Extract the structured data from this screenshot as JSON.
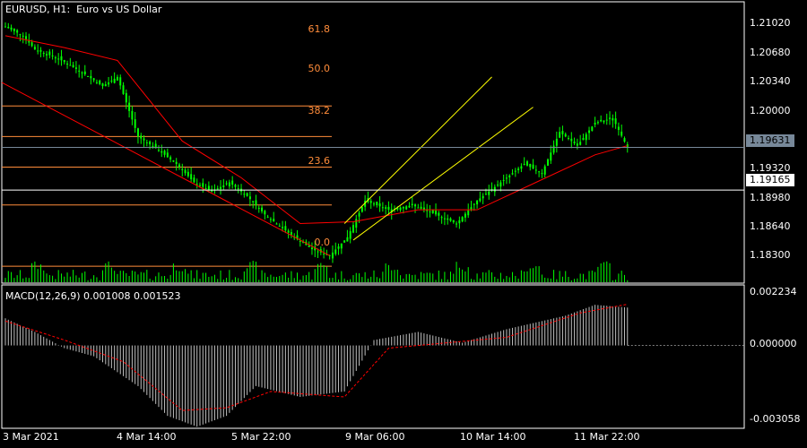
{
  "window": {
    "symbol": "EURUSD",
    "timeframe": "H1",
    "description": "Euro vs US Dollar"
  },
  "colors": {
    "background": "#000000",
    "frame": "#ffffff",
    "bull_candle": "#00ff00",
    "bear_candle": "#00ff00",
    "moving_average": "#ff0000",
    "fibonacci": "#ff8c3a",
    "trend_channel": "#ffff00",
    "macd_histogram": "#c0c0c0",
    "macd_signal": "#ff0000",
    "volumes": "#00ff00",
    "bid_line": "#778899",
    "highlight_line": "#ffffff"
  },
  "price_axis": {
    "ticks": [
      "1.21020",
      "1.20680",
      "1.20340",
      "1.20000",
      "1.19320",
      "1.18980",
      "1.18640",
      "1.18300"
    ],
    "current_bid": "1.19631",
    "horizontal_line": "1.19165",
    "range": [
      1.1815,
      1.2122
    ]
  },
  "fibonacci": {
    "levels": [
      "61.8",
      "50.0",
      "38.2",
      "23.6",
      "0.0"
    ]
  },
  "macd": {
    "label": "MACD(12,26,9) 0.001008 0.001523",
    "axis_ticks": [
      "0.002234",
      "0.000000",
      "-0.003058"
    ],
    "range": [
      -0.003058,
      0.002234
    ]
  },
  "time_axis": {
    "labels": [
      "3 Mar 2021",
      "4 Mar 14:00",
      "5 Mar 22:00",
      "9 Mar 06:00",
      "10 Mar 14:00",
      "11 Mar 22:00"
    ]
  },
  "chart_data": {
    "type": "candlestick",
    "symbol": "EURUSD",
    "timeframe": "H1",
    "price_range": [
      1.1815,
      1.2122
    ],
    "close_path": [
      {
        "t": 0,
        "price": 1.2095
      },
      {
        "t": 6,
        "price": 1.2085
      },
      {
        "t": 10,
        "price": 1.207
      },
      {
        "t": 18,
        "price": 1.206
      },
      {
        "t": 26,
        "price": 1.2045
      },
      {
        "t": 33,
        "price": 1.203
      },
      {
        "t": 38,
        "price": 1.204
      },
      {
        "t": 45,
        "price": 1.1975
      },
      {
        "t": 52,
        "price": 1.196
      },
      {
        "t": 58,
        "price": 1.1945
      },
      {
        "t": 64,
        "price": 1.1925
      },
      {
        "t": 70,
        "price": 1.1915
      },
      {
        "t": 76,
        "price": 1.1925
      },
      {
        "t": 82,
        "price": 1.191
      },
      {
        "t": 88,
        "price": 1.189
      },
      {
        "t": 96,
        "price": 1.187
      },
      {
        "t": 104,
        "price": 1.1852
      },
      {
        "t": 110,
        "price": 1.1845
      },
      {
        "t": 116,
        "price": 1.1865
      },
      {
        "t": 122,
        "price": 1.1905
      },
      {
        "t": 130,
        "price": 1.1895
      },
      {
        "t": 138,
        "price": 1.19
      },
      {
        "t": 146,
        "price": 1.189
      },
      {
        "t": 153,
        "price": 1.188
      },
      {
        "t": 160,
        "price": 1.1905
      },
      {
        "t": 168,
        "price": 1.1925
      },
      {
        "t": 176,
        "price": 1.1945
      },
      {
        "t": 182,
        "price": 1.1935
      },
      {
        "t": 188,
        "price": 1.198
      },
      {
        "t": 194,
        "price": 1.1965
      },
      {
        "t": 200,
        "price": 1.199
      },
      {
        "t": 206,
        "price": 1.1995
      },
      {
        "t": 211,
        "price": 1.1963
      }
    ],
    "moving_average": [
      {
        "t": 0,
        "price": 1.2085
      },
      {
        "t": 20,
        "price": 1.2072
      },
      {
        "t": 38,
        "price": 1.2058
      },
      {
        "t": 50,
        "price": 1.201
      },
      {
        "t": 60,
        "price": 1.197
      },
      {
        "t": 80,
        "price": 1.193
      },
      {
        "t": 100,
        "price": 1.188
      },
      {
        "t": 118,
        "price": 1.1882
      },
      {
        "t": 140,
        "price": 1.1895
      },
      {
        "t": 160,
        "price": 1.1895
      },
      {
        "t": 180,
        "price": 1.1925
      },
      {
        "t": 200,
        "price": 1.1955
      },
      {
        "t": 211,
        "price": 1.1965
      }
    ],
    "macd_series": [
      {
        "t": 0,
        "value": 0.001
      },
      {
        "t": 10,
        "value": 0.0005
      },
      {
        "t": 20,
        "value": -0.0001
      },
      {
        "t": 30,
        "value": -0.0004
      },
      {
        "t": 45,
        "value": -0.0015
      },
      {
        "t": 55,
        "value": -0.0026
      },
      {
        "t": 65,
        "value": -0.003
      },
      {
        "t": 75,
        "value": -0.0026
      },
      {
        "t": 85,
        "value": -0.0015
      },
      {
        "t": 100,
        "value": -0.0019
      },
      {
        "t": 115,
        "value": -0.0017
      },
      {
        "t": 125,
        "value": 0.0002
      },
      {
        "t": 140,
        "value": 0.0005
      },
      {
        "t": 155,
        "value": 0.0001
      },
      {
        "t": 170,
        "value": 0.0006
      },
      {
        "t": 190,
        "value": 0.0011
      },
      {
        "t": 200,
        "value": 0.0015
      },
      {
        "t": 211,
        "value": 0.0014
      }
    ],
    "macd_signal": [
      {
        "t": 0,
        "value": 0.0009
      },
      {
        "t": 20,
        "value": 0.0002
      },
      {
        "t": 40,
        "value": -0.0006
      },
      {
        "t": 60,
        "value": -0.0024
      },
      {
        "t": 75,
        "value": -0.0023
      },
      {
        "t": 90,
        "value": -0.0017
      },
      {
        "t": 115,
        "value": -0.0019
      },
      {
        "t": 130,
        "value": -0.0001
      },
      {
        "t": 150,
        "value": 0.0001
      },
      {
        "t": 170,
        "value": 0.0003
      },
      {
        "t": 195,
        "value": 0.0012
      },
      {
        "t": 211,
        "value": 0.00152
      }
    ]
  }
}
